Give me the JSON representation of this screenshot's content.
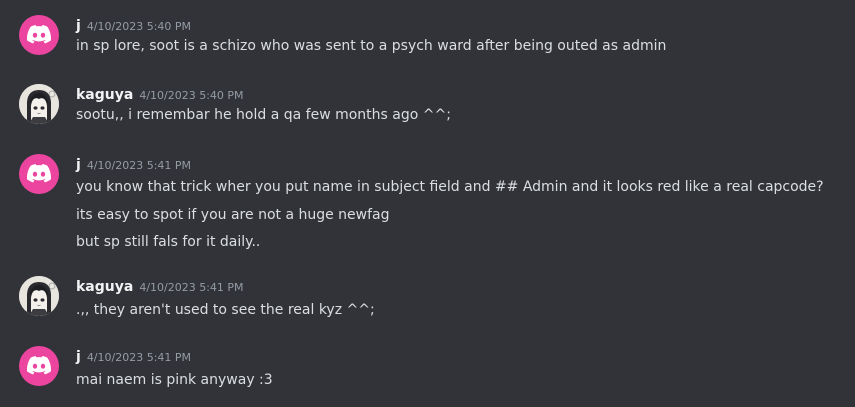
{
  "messages": [
    {
      "username": "j",
      "timestamp": "4/10/2023 5:40 PM",
      "avatar": "discord-logo-icon",
      "lines": [
        "in sp lore, soot is a schizo who was sent to a psych ward after being outed as admin"
      ]
    },
    {
      "username": "kaguya",
      "timestamp": "4/10/2023 5:40 PM",
      "avatar": "anime-girl-avatar-icon",
      "lines": [
        "sootu,, i remembar he hold a qa few months ago ^^;"
      ]
    },
    {
      "username": "j",
      "timestamp": "4/10/2023 5:41 PM",
      "avatar": "discord-logo-icon",
      "lines": [
        "you know that trick wher you put name in subject field and ## Admin and it looks red like a real capcode?",
        "its easy to spot if you are not a huge newfag",
        "but sp still fals for it daily.."
      ]
    },
    {
      "username": "kaguya",
      "timestamp": "4/10/2023 5:41 PM",
      "avatar": "anime-girl-avatar-icon",
      "lines": [
        ".,, they aren't used to see the real kyz ^^;"
      ]
    },
    {
      "username": "j",
      "timestamp": "4/10/2023 5:41 PM",
      "avatar": "discord-logo-icon",
      "lines": [
        "mai naem is pink anyway :3"
      ]
    }
  ],
  "colors": {
    "background": "#313338",
    "discord_avatar": "#eb459f",
    "username": "#f2f3f5",
    "timestamp": "#949ba4",
    "text": "#dbdee1"
  }
}
